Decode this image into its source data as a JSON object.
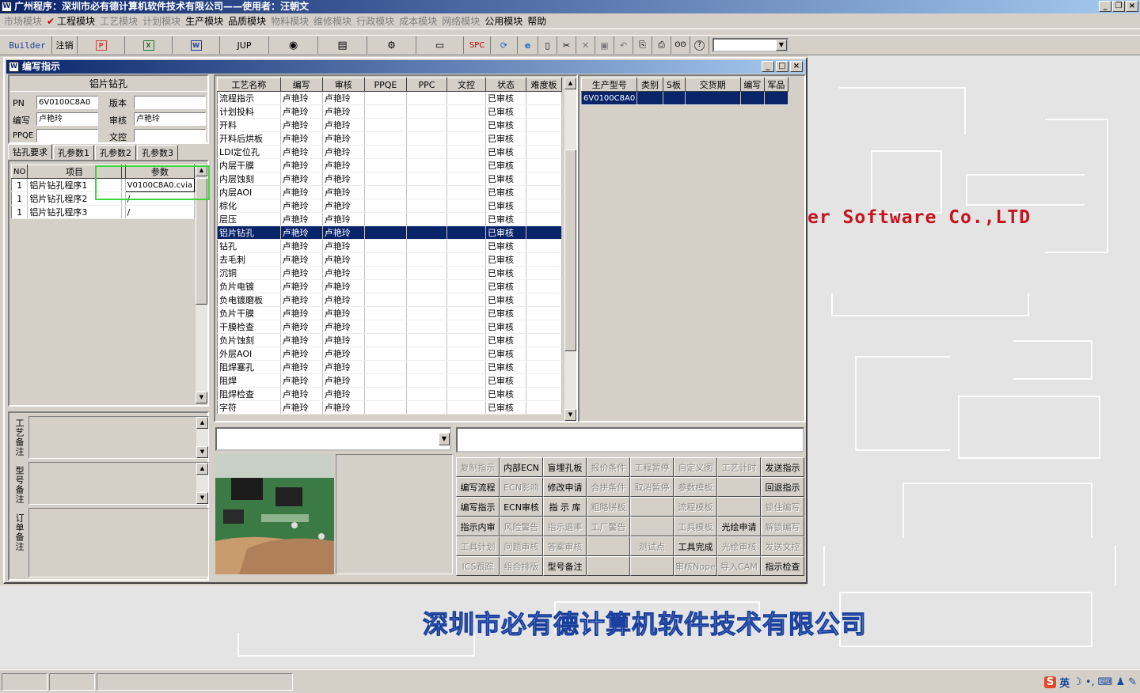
{
  "window": {
    "title": "广州程序：深圳市必有德计算机软件技术有限公司——使用者：汪朝文"
  },
  "menu": [
    {
      "label": "市场模块",
      "enabled": false
    },
    {
      "label": "工程模块",
      "enabled": true,
      "checked": true
    },
    {
      "label": "工艺模块",
      "enabled": false
    },
    {
      "label": "计划模块",
      "enabled": false
    },
    {
      "label": "生产模块",
      "enabled": true
    },
    {
      "label": "品质模块",
      "enabled": true
    },
    {
      "label": "物料模块",
      "enabled": false
    },
    {
      "label": "维修模块",
      "enabled": false
    },
    {
      "label": "行政模块",
      "enabled": false
    },
    {
      "label": "成本模块",
      "enabled": false
    },
    {
      "label": "网络模块",
      "enabled": false
    },
    {
      "label": "公用模块",
      "enabled": true
    },
    {
      "label": "帮助",
      "enabled": true
    }
  ],
  "toolbar": {
    "builder": "Builder",
    "logout": "注销",
    "jup": "JUP",
    "spc": "SPC"
  },
  "child": {
    "title": "编写指示"
  },
  "left": {
    "section_title": "铝片钻孔",
    "pn_label": "PN",
    "pn_value": "6V0100C8A0",
    "version_label": "版本",
    "version_value": "",
    "writer_label": "编写",
    "writer_value": "卢艳玲",
    "reviewer_label": "审核",
    "reviewer_value": "卢艳玲",
    "ppqe_label": "PPQE",
    "ppqe_value": "",
    "wenkong_label": "文控",
    "wenkong_value": "",
    "tabs": [
      "钻孔要求",
      "孔参数1",
      "孔参数2",
      "孔参数3"
    ],
    "grid_headers": [
      "NO",
      "项目",
      "",
      "参数"
    ],
    "grid_rows": [
      {
        "no": "1",
        "item": "铝片钻孔程序1",
        "param": "V0100C8A0.cvia"
      },
      {
        "no": "1",
        "item": "铝片钻孔程序2",
        "param": "/"
      },
      {
        "no": "1",
        "item": "铝片钻孔程序3",
        "param": "/"
      }
    ],
    "note_labels": [
      "工艺备注",
      "型号备注",
      "订单备注"
    ]
  },
  "process": {
    "headers": [
      "工艺名称",
      "编写",
      "审核",
      "PPQE",
      "PPC",
      "文控",
      "状态",
      "难度板"
    ],
    "rows": [
      [
        "流程指示",
        "卢艳玲",
        "卢艳玲",
        "",
        "",
        "",
        "已审核",
        ""
      ],
      [
        "计划投料",
        "卢艳玲",
        "卢艳玲",
        "",
        "",
        "",
        "已审核",
        ""
      ],
      [
        "开料",
        "卢艳玲",
        "卢艳玲",
        "",
        "",
        "",
        "已审核",
        ""
      ],
      [
        "开料后烘板",
        "卢艳玲",
        "卢艳玲",
        "",
        "",
        "",
        "已审核",
        ""
      ],
      [
        "LDI定位孔",
        "卢艳玲",
        "卢艳玲",
        "",
        "",
        "",
        "已审核",
        ""
      ],
      [
        "内层干膜",
        "卢艳玲",
        "卢艳玲",
        "",
        "",
        "",
        "已审核",
        ""
      ],
      [
        "内层蚀刻",
        "卢艳玲",
        "卢艳玲",
        "",
        "",
        "",
        "已审核",
        ""
      ],
      [
        "内层AOI",
        "卢艳玲",
        "卢艳玲",
        "",
        "",
        "",
        "已审核",
        ""
      ],
      [
        "棕化",
        "卢艳玲",
        "卢艳玲",
        "",
        "",
        "",
        "已审核",
        ""
      ],
      [
        "层压",
        "卢艳玲",
        "卢艳玲",
        "",
        "",
        "",
        "已审核",
        ""
      ],
      [
        "铝片钻孔",
        "卢艳玲",
        "卢艳玲",
        "",
        "",
        "",
        "已审核",
        ""
      ],
      [
        "钻孔",
        "卢艳玲",
        "卢艳玲",
        "",
        "",
        "",
        "已审核",
        ""
      ],
      [
        "去毛刺",
        "卢艳玲",
        "卢艳玲",
        "",
        "",
        "",
        "已审核",
        ""
      ],
      [
        "沉铜",
        "卢艳玲",
        "卢艳玲",
        "",
        "",
        "",
        "已审核",
        ""
      ],
      [
        "负片电镀",
        "卢艳玲",
        "卢艳玲",
        "",
        "",
        "",
        "已审核",
        ""
      ],
      [
        "负电镀磨板",
        "卢艳玲",
        "卢艳玲",
        "",
        "",
        "",
        "已审核",
        ""
      ],
      [
        "负片干膜",
        "卢艳玲",
        "卢艳玲",
        "",
        "",
        "",
        "已审核",
        ""
      ],
      [
        "干膜检查",
        "卢艳玲",
        "卢艳玲",
        "",
        "",
        "",
        "已审核",
        ""
      ],
      [
        "负片蚀刻",
        "卢艳玲",
        "卢艳玲",
        "",
        "",
        "",
        "已审核",
        ""
      ],
      [
        "外层AOI",
        "卢艳玲",
        "卢艳玲",
        "",
        "",
        "",
        "已审核",
        ""
      ],
      [
        "阻焊塞孔",
        "卢艳玲",
        "卢艳玲",
        "",
        "",
        "",
        "已审核",
        ""
      ],
      [
        "阻焊",
        "卢艳玲",
        "卢艳玲",
        "",
        "",
        "",
        "已审核",
        ""
      ],
      [
        "阻焊检查",
        "卢艳玲",
        "卢艳玲",
        "",
        "",
        "",
        "已审核",
        ""
      ],
      [
        "字符",
        "卢艳玲",
        "卢艳玲",
        "",
        "",
        "",
        "已审核",
        ""
      ]
    ],
    "selected_index": 10
  },
  "production": {
    "headers": [
      "生产型号",
      "类别",
      "S板",
      "交货期",
      "编写",
      "军品"
    ],
    "rows": [
      [
        "6V0100C8A0",
        "",
        "",
        "",
        "",
        ""
      ]
    ]
  },
  "actions": [
    {
      "label": "复制指示",
      "enabled": false
    },
    {
      "label": "内部ECN",
      "enabled": true
    },
    {
      "label": "盲埋孔板",
      "enabled": true
    },
    {
      "label": "报价条件",
      "enabled": false
    },
    {
      "label": "工程暂停",
      "enabled": false
    },
    {
      "label": "自定义图",
      "enabled": false
    },
    {
      "label": "工艺计时",
      "enabled": false
    },
    {
      "label": "发送指示",
      "enabled": true
    },
    {
      "label": "编写流程",
      "enabled": true
    },
    {
      "label": "ECN影响",
      "enabled": false
    },
    {
      "label": "修改申请",
      "enabled": true
    },
    {
      "label": "合拼条件",
      "enabled": false
    },
    {
      "label": "取消暂停",
      "enabled": false
    },
    {
      "label": "参数模板",
      "enabled": false
    },
    {
      "label": "",
      "enabled": false
    },
    {
      "label": "回退指示",
      "enabled": true
    },
    {
      "label": "编写指示",
      "enabled": true
    },
    {
      "label": "ECN审核",
      "enabled": true
    },
    {
      "label": "指 示 库",
      "enabled": true
    },
    {
      "label": "粗略拼板",
      "enabled": false
    },
    {
      "label": "",
      "enabled": false
    },
    {
      "label": "流程模板",
      "enabled": false
    },
    {
      "label": "",
      "enabled": false
    },
    {
      "label": "锁住编写",
      "enabled": false
    },
    {
      "label": "指示内审",
      "enabled": true
    },
    {
      "label": "风险警告",
      "enabled": false
    },
    {
      "label": "指示退率",
      "enabled": false
    },
    {
      "label": "工厂警告",
      "enabled": false
    },
    {
      "label": "",
      "enabled": false
    },
    {
      "label": "工具模板",
      "enabled": false
    },
    {
      "label": "光绘申请",
      "enabled": true
    },
    {
      "label": "解锁编写",
      "enabled": false
    },
    {
      "label": "工具计划",
      "enabled": false
    },
    {
      "label": "问题审核",
      "enabled": false
    },
    {
      "label": "答案审核",
      "enabled": false
    },
    {
      "label": "",
      "enabled": false
    },
    {
      "label": "测试点",
      "enabled": false
    },
    {
      "label": "工具完成",
      "enabled": true
    },
    {
      "label": "光绘审核",
      "enabled": false
    },
    {
      "label": "发送文控",
      "enabled": false
    },
    {
      "label": "ICS跟踪",
      "enabled": false
    },
    {
      "label": "组合排版",
      "enabled": false
    },
    {
      "label": "型号备注",
      "enabled": true
    },
    {
      "label": "",
      "enabled": false
    },
    {
      "label": "",
      "enabled": false
    },
    {
      "label": "审核Nope",
      "enabled": false
    },
    {
      "label": "导入CAM",
      "enabled": false
    },
    {
      "label": "指示检查",
      "enabled": true
    }
  ],
  "desktop": {
    "brand_fragment": "er Software Co.,LTD",
    "company": "深圳市必有德计算机软件技术有限公司"
  },
  "tray": {
    "ime_label": "英"
  }
}
